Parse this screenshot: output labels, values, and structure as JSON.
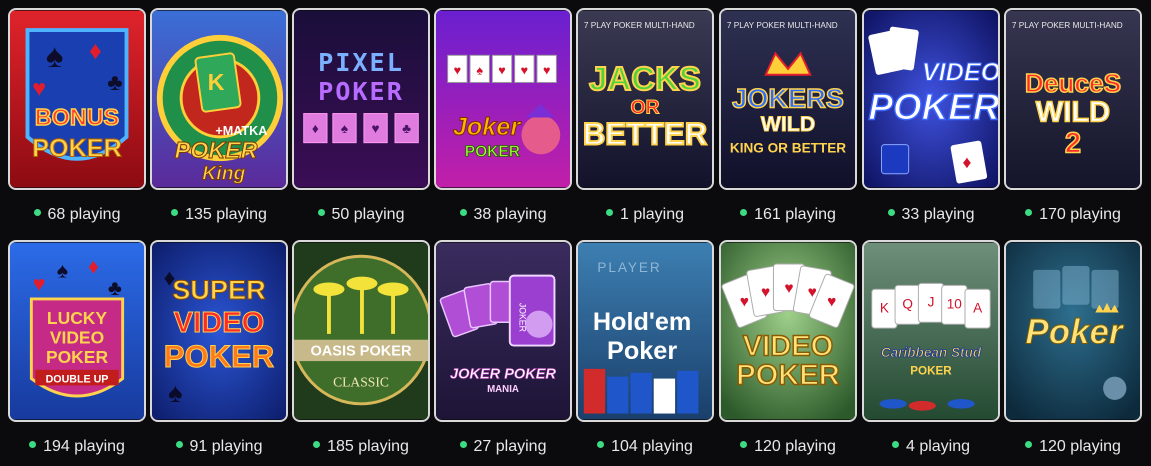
{
  "games": [
    {
      "title_lines": [
        "BONUS",
        "POKER"
      ],
      "playing": "68 playing"
    },
    {
      "title_lines": [
        "+MATKA",
        "POKER",
        "King"
      ],
      "playing": "135 playing"
    },
    {
      "title_lines": [
        "PIXEL",
        "POKER"
      ],
      "playing": "50 playing"
    },
    {
      "title_lines": [
        "Joker",
        "POKER"
      ],
      "playing": "38 playing"
    },
    {
      "title_lines": [
        "7 PLAY POKER MULTI-HAND",
        "JACKS",
        "OR",
        "BETTER"
      ],
      "playing": "1 playing"
    },
    {
      "title_lines": [
        "7 PLAY POKER MULTI-HAND",
        "JOKERS",
        "WILD",
        "KING OR BETTER"
      ],
      "playing": "161 playing"
    },
    {
      "title_lines": [
        "VIDEO",
        "POKER"
      ],
      "playing": "33 playing"
    },
    {
      "title_lines": [
        "7 PLAY POKER MULTI-HAND",
        "DeuceS",
        "WILD",
        "2"
      ],
      "playing": "170 playing"
    },
    {
      "title_lines": [
        "LUCKY",
        "VIDEO",
        "POKER",
        "DOUBLE UP"
      ],
      "playing": "194 playing"
    },
    {
      "title_lines": [
        "SUPER",
        "VIDEO",
        "POKER"
      ],
      "playing": "91 playing"
    },
    {
      "title_lines": [
        "OASIS POKER",
        "CLASSIC"
      ],
      "playing": "185 playing"
    },
    {
      "title_lines": [
        "JOKER",
        "JOKER POKER",
        "MANIA"
      ],
      "playing": "27 playing"
    },
    {
      "title_lines": [
        "PLAYER",
        "Hold'em",
        "Poker"
      ],
      "playing": "104 playing"
    },
    {
      "title_lines": [
        "VIDEO",
        "POKER"
      ],
      "playing": "120 playing"
    },
    {
      "title_lines": [
        "Caribbean Stud",
        "POKER"
      ],
      "playing": "4 playing"
    },
    {
      "title_lines": [
        "Poker"
      ],
      "playing": "120 playing"
    }
  ],
  "colors": {
    "online_dot": "#3ddc84",
    "border": "#d9d9d9",
    "background": "#0b0b0d"
  }
}
